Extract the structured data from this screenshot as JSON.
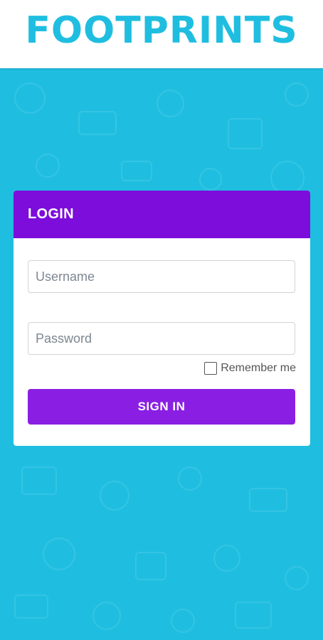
{
  "app": {
    "logo_text": "FOOTPRINTS"
  },
  "login": {
    "title": "LOGIN",
    "username_placeholder": "Username",
    "password_placeholder": "Password",
    "remember_label": "Remember me",
    "remember_checked": false,
    "signin_label": "SIGN IN"
  },
  "colors": {
    "brand": "#1fbee0",
    "card_header": "#7c0ddb",
    "signin_button": "#8a1fe3",
    "card_bg": "#ffffff"
  }
}
